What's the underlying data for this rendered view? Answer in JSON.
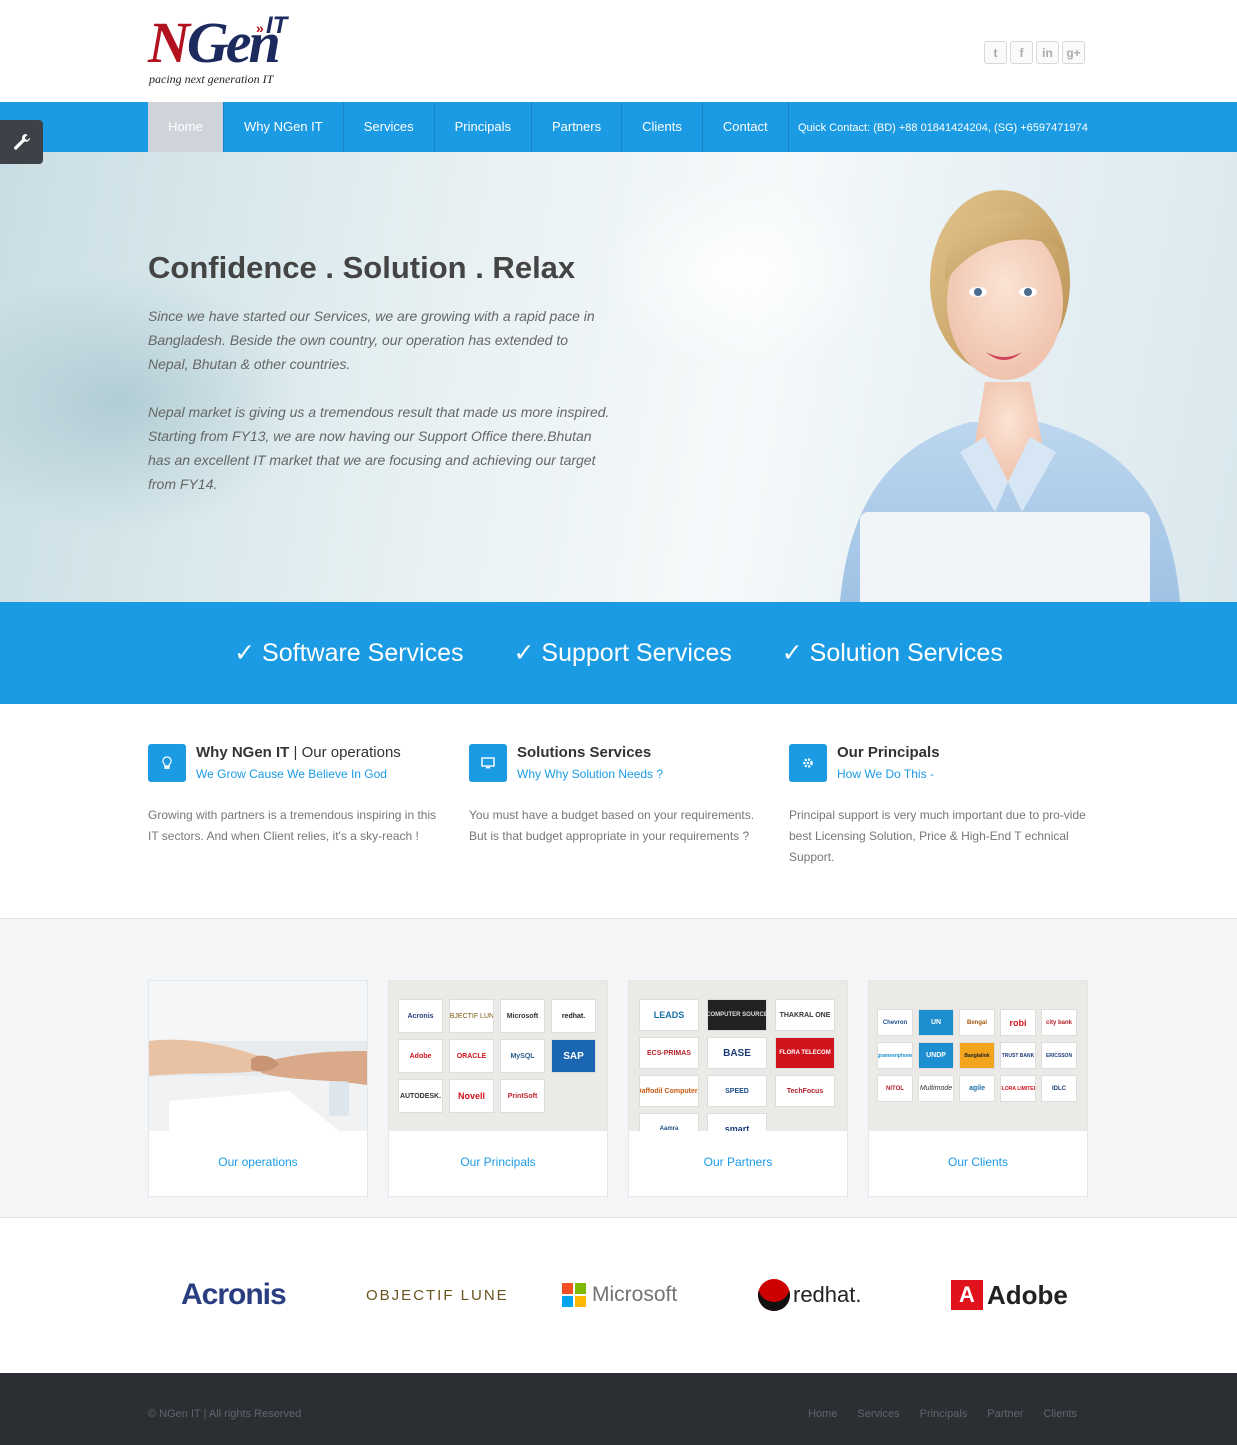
{
  "header": {
    "logo_main_n": "N",
    "logo_main_gen": "Gen",
    "logo_it": "IT",
    "logo_tagline": "pacing next generation IT",
    "social": [
      "twitter-icon",
      "facebook-icon",
      "linkedin-icon",
      "google-plus-icon"
    ],
    "social_glyphs": [
      "t",
      "f",
      "in",
      "g+"
    ]
  },
  "nav": {
    "items": [
      "Home",
      "Why NGen IT",
      "Services",
      "Principals",
      "Partners",
      "Clients",
      "Contact"
    ],
    "quick_contact": "Quick Contact: (BD) +88 01841424204, (SG) +6597471974"
  },
  "hero": {
    "title": "Confidence . Solution . Relax",
    "para1": "Since we have started our Services, we are growing with a rapid pace in Bangladesh. Beside the own country, our operation has extended to Nepal, Bhutan & other countries.",
    "para2": "Nepal market is giving us a tremendous result that made us more inspired. Starting from FY13, we are now having our Support Office there.Bhutan has an excellent IT market that we are focusing and achieving our target from FY14."
  },
  "band": {
    "items": [
      "✓ Software Services",
      "✓ Support Services",
      "✓ Solution Services"
    ]
  },
  "features": [
    {
      "icon": "lightbulb-icon",
      "title": "Why NGen IT",
      "title_rest": " | Our operations",
      "subtitle": "We Grow Cause We Believe In God",
      "body": "Growing with partners is a tremendous inspiring in this IT sectors. And when Client relies, it's a sky-reach !"
    },
    {
      "icon": "monitor-icon",
      "title": "Solutions Services",
      "title_rest": "",
      "subtitle": "Why Why Solution Needs ?",
      "body": "You must have a budget based on your requirements. But is that budget appropriate in your requirements ?"
    },
    {
      "icon": "gear-icon",
      "title": "Our Principals",
      "title_rest": "",
      "subtitle": "How We Do This -",
      "body": "Principal support is very much important due to pro-vide best Licensing Solution, Price & High-End T echnical Support."
    }
  ],
  "portfolio": [
    {
      "caption": "Our operations"
    },
    {
      "caption": "Our Principals",
      "logos": [
        "Acronis",
        "OBJECTIF LUNE",
        "Microsoft",
        "redhat.",
        "Adobe",
        "ORACLE",
        "MySQL",
        "SAP",
        "AUTODESK.",
        "Novell",
        "PrintSoft"
      ]
    },
    {
      "caption": "Our Partners",
      "logos": [
        "LEADS",
        "COMPUTER SOURCE",
        "THAKRAL ONE",
        "ECS-PRIMAS",
        "BASE",
        "FLORA TELECOM",
        "Daffodil Computers",
        "SPEED",
        "TechFocus",
        "Aamra",
        "smart"
      ]
    },
    {
      "caption": "Our Clients",
      "logos": [
        "Chevron",
        "UN",
        "Bengal",
        "robi",
        "city bank",
        "grameenphone",
        "UNDP",
        "Banglalink",
        "TRUST BANK",
        "ERICSSON",
        "NITOL",
        "Multimode",
        "agile",
        "FLORA LIMITED",
        "IDLC"
      ]
    }
  ],
  "brands": [
    "Acronis",
    "OBJECTIF LUNE",
    "Microsoft",
    "redhat.",
    "Adobe"
  ],
  "footer": {
    "copyright": "© NGen IT | All rights Reserved",
    "links": [
      "Home",
      "Services",
      "Principals",
      "Partner",
      "Clients"
    ]
  },
  "colors": {
    "accent": "#1a9be4",
    "logo_red": "#b2121f",
    "logo_navy": "#1c2a5e",
    "footer_bg": "#2b2e33"
  }
}
